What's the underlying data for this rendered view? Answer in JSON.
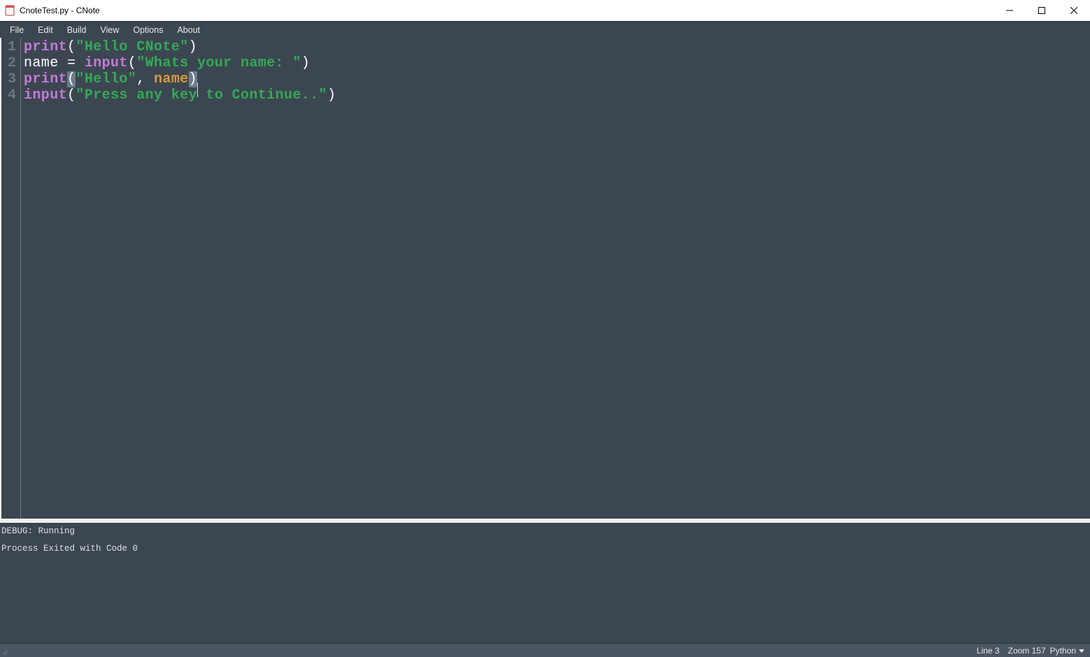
{
  "titlebar": {
    "title": "CnoteTest.py - CNote"
  },
  "menubar": {
    "items": [
      "File",
      "Edit",
      "Build",
      "View",
      "Options",
      "About"
    ]
  },
  "editor": {
    "line_numbers": [
      "1",
      "2",
      "3",
      "4"
    ],
    "lines": [
      {
        "tokens": [
          {
            "cls": "tok-fn",
            "t": "print"
          },
          {
            "cls": "tok-paren",
            "t": "("
          },
          {
            "cls": "tok-str",
            "t": "\"Hello CNote\""
          },
          {
            "cls": "tok-paren",
            "t": ")"
          }
        ]
      },
      {
        "tokens": [
          {
            "cls": "tok-ident",
            "t": "name"
          },
          {
            "cls": "tok-op",
            "t": " = "
          },
          {
            "cls": "tok-fn",
            "t": "input"
          },
          {
            "cls": "tok-paren",
            "t": "("
          },
          {
            "cls": "tok-str",
            "t": "\"Whats your name: \""
          },
          {
            "cls": "tok-paren",
            "t": ")"
          }
        ]
      },
      {
        "cursor_after": true,
        "tokens": [
          {
            "cls": "tok-fn",
            "t": "print"
          },
          {
            "cls": "tok-paren bracket-hl",
            "t": "("
          },
          {
            "cls": "tok-str",
            "t": "\"Hello\""
          },
          {
            "cls": "tok-ident",
            "t": ", "
          },
          {
            "cls": "tok-var",
            "t": "name"
          },
          {
            "cls": "tok-paren bracket-hl",
            "t": ")"
          }
        ]
      },
      {
        "tokens": [
          {
            "cls": "tok-fn",
            "t": "input"
          },
          {
            "cls": "tok-paren",
            "t": "("
          },
          {
            "cls": "tok-str",
            "t": "\"Press any key to Continue..\""
          },
          {
            "cls": "tok-paren",
            "t": ")"
          }
        ]
      }
    ]
  },
  "console": {
    "lines": [
      "DEBUG: Running",
      "",
      "Process Exited with Code 0"
    ]
  },
  "statusbar": {
    "line_info": "Line 3",
    "zoom_info": "Zoom 157",
    "language": "Python"
  }
}
